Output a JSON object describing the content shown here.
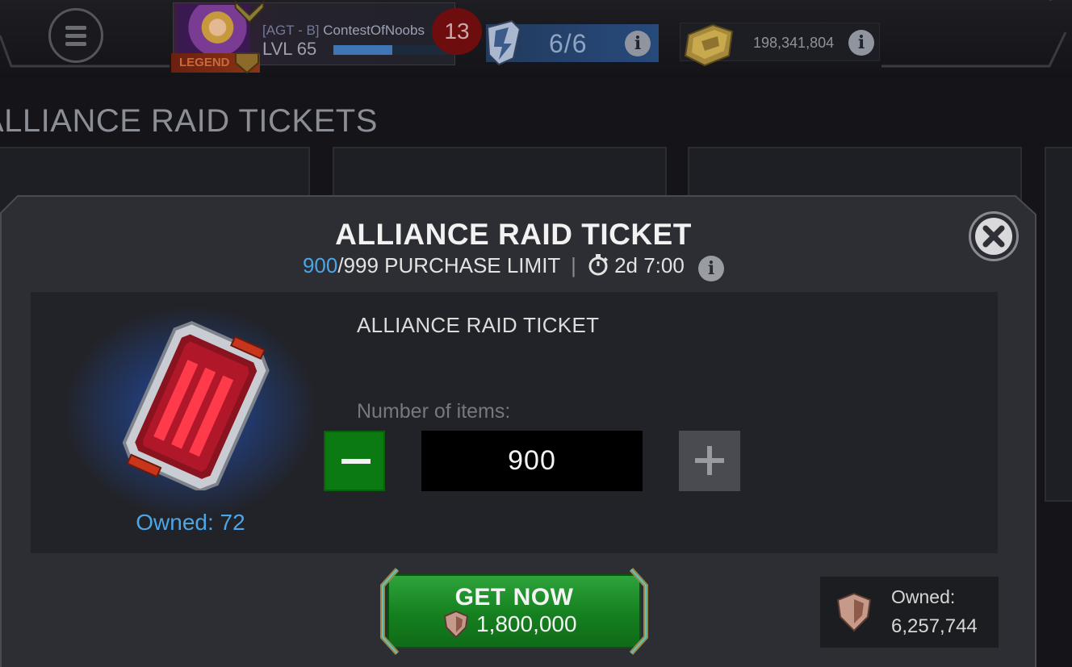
{
  "header": {
    "profile": {
      "alliance_tag": "[AGT - B]",
      "player_name": "ContestOfNoobs",
      "level": "LVL 65",
      "tier_badge": "LEGEND",
      "xp_progress": 0.5,
      "notifications": "13"
    },
    "energy": {
      "value": "6/6",
      "icon": "energy-icon"
    },
    "gold": {
      "value": "198,341,804",
      "icon": "gold-icon"
    }
  },
  "page": {
    "title": "ALLIANCE RAID TICKETS"
  },
  "modal": {
    "title": "ALLIANCE RAID TICKET",
    "purchase": {
      "current": "900",
      "max": "/999 PURCHASE LIMIT",
      "separator": "|",
      "timer": "2d 7:00"
    },
    "item": {
      "name": "ALLIANCE RAID TICKET",
      "owned": "Owned: 72",
      "icon": "raid-ticket-icon"
    },
    "quantity": {
      "label": "Number of items:",
      "value": "900"
    },
    "get_button": {
      "label": "GET NOW",
      "price": "1,800,000"
    },
    "currency": {
      "label": "Owned:",
      "value": "6,257,744",
      "icon": "alliance-token-icon"
    }
  },
  "colors": {
    "accent_blue": "#4aa6e8",
    "button_green": "#15801f",
    "modal_bg": "#2d2e33"
  }
}
